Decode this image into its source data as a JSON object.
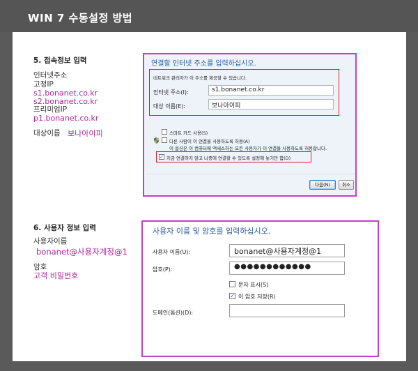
{
  "header": {
    "title": "WIN 7 수동설정 방법"
  },
  "section5": {
    "title": "5. 접속정보 입력",
    "address_label": "인터넷주소",
    "fixed_ip_label": "고정IP",
    "fixed_ip_1": "s1.bonanet.co.kr",
    "fixed_ip_2": "s2.bonanet.co.kr",
    "premium_ip_label": "프리미엄IP",
    "premium_ip_1": "p1.bonanet.co.kr",
    "dest_label": "대상이름",
    "dest_value": "보나아이피"
  },
  "dialog1": {
    "heading": "연결할 인터넷 주소를 입력하십시오.",
    "admin_note": "네트워크 관리자가 이 주소를 제공할 수 있습니다.",
    "address_label": "인터넷 주소(I):",
    "address_value": "s1.bonanet.co.kr",
    "dest_label": "대상 이름(E):",
    "dest_value": "보나아이피",
    "smartcard_label": "스마트 카드 사용(S)",
    "allow_others_label": "다른 사람이 이 연결을 사용하도록 허용(A)",
    "allow_others_note": "이 옵션은 이 컴퓨터에 액세스하는 모든 사용자가 이 연결을 사용하도록 허용합니다.",
    "dont_connect_label": "지금 연결하지 않고 나중에 연결할 수 있도록 설정해 놓기만 함(D)",
    "dont_connect_check": "✓",
    "next_button": "다음(N)",
    "cancel_button": "취소"
  },
  "section6": {
    "title": "6. 사용자 정보 입력",
    "username_label": "사용자이름",
    "username_value": "bonanet@사용자계정@1",
    "password_label": "암호",
    "password_value": "고객 비밀번호"
  },
  "dialog2": {
    "heading": "사용자 이름 및 암호를 입력하십시오.",
    "username_label": "사용자 이름(U):",
    "username_value": "bonanet@사용자계정@1",
    "password_label": "암호(P):",
    "password_value": "●●●●●●●●●●●●",
    "show_chars_label": "문자 표시(S)",
    "remember_label": "이 암호 저장(R)",
    "remember_check": "✓",
    "domain_label": "도메인(옵션)(D):",
    "domain_value": ""
  },
  "colors": {
    "accent_purple": "#b0269c",
    "frame_magenta": "#c53ec9",
    "highlight_red": "#d4202c",
    "dialog_blue": "#2f5b9c"
  }
}
